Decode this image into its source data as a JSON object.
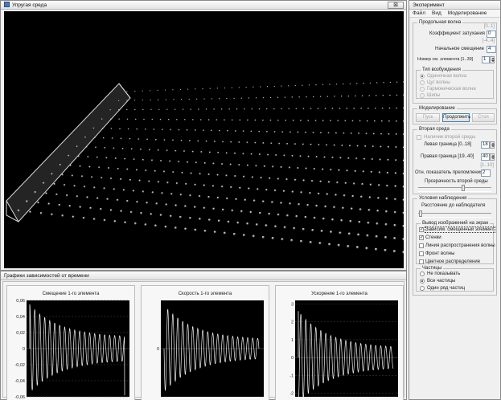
{
  "sim_window": {
    "title": "Упругая среда",
    "close_glyph": "⊠"
  },
  "graphs_window": {
    "title": "Графики зависимостей от времени",
    "panels": [
      {
        "title": "Смещение 1-го элемента",
        "y_labels": [
          "0,06",
          "0,04",
          "0,02",
          "0",
          "-0,02",
          "-0,04",
          "-0,06"
        ],
        "y_range": [
          -0.06,
          0.06
        ],
        "amplitude": 0.055
      },
      {
        "title": "Скорость 1-го элемента",
        "y_labels": [
          "0"
        ],
        "y_range": [
          -1,
          1
        ],
        "amplitude": 0.9
      },
      {
        "title": "Ускорение 1-го элемента",
        "y_labels": [
          "3",
          "2",
          "1",
          "0",
          "-1",
          "-2"
        ],
        "y_range": [
          -2.2,
          3.2
        ],
        "amplitude": 2.6
      }
    ]
  },
  "experiment": {
    "title": "Эксперимент",
    "menu": [
      "Файл",
      "Вид",
      "Моделирование"
    ],
    "longitudinal": {
      "title": "Продольная волна",
      "damping_label": "Коэффициент затухания",
      "damping_range": "[0..1]",
      "damping_value": "0",
      "shift_label": "Начальное смещение",
      "shift_range": "[-4..4]",
      "shift_value": "4",
      "element_label": "Номер см. элемента  [1..39]",
      "element_value": "1"
    },
    "excitation": {
      "title": "Тип возбуждения",
      "options": [
        "Одиночная волна",
        "Цуг волны",
        "Гармоническая волна",
        "Шипы"
      ],
      "selected": 0
    },
    "modeling": {
      "title": "Моделирование",
      "start": "Пуск",
      "continue": "Продолжить",
      "stop": "Стоп"
    },
    "second_medium": {
      "title": "Вторая среда",
      "presence_label": "Наличие второй среды",
      "left_label": "Левая граница  [0..18]",
      "left_value": "18",
      "right_label": "Правая граница  [19..40]",
      "right_value": "40",
      "refr_range": "[1..10]",
      "refr_label": "Отн. показатель преломления",
      "refr_value": "2",
      "transp_label": "Прозрачность второй среды"
    },
    "observation": {
      "title": "Условия наблюдения",
      "distance_label": "Расстояние до наблюдателя",
      "output": {
        "title": "Вывод изображений на экран",
        "items": [
          {
            "label": "Зависим. смещенный элемент",
            "checked": true
          },
          {
            "label": "Стенки",
            "checked": true
          },
          {
            "label": "Линия распространения волны",
            "checked": false
          },
          {
            "label": "Фронт волны",
            "checked": false
          },
          {
            "label": "Цветное распределение",
            "checked": false
          }
        ]
      },
      "particles": {
        "title": "Частицы",
        "options": [
          "Не показывать",
          "Все частицы",
          "Один ряд частиц"
        ],
        "selected": 1
      }
    }
  }
}
